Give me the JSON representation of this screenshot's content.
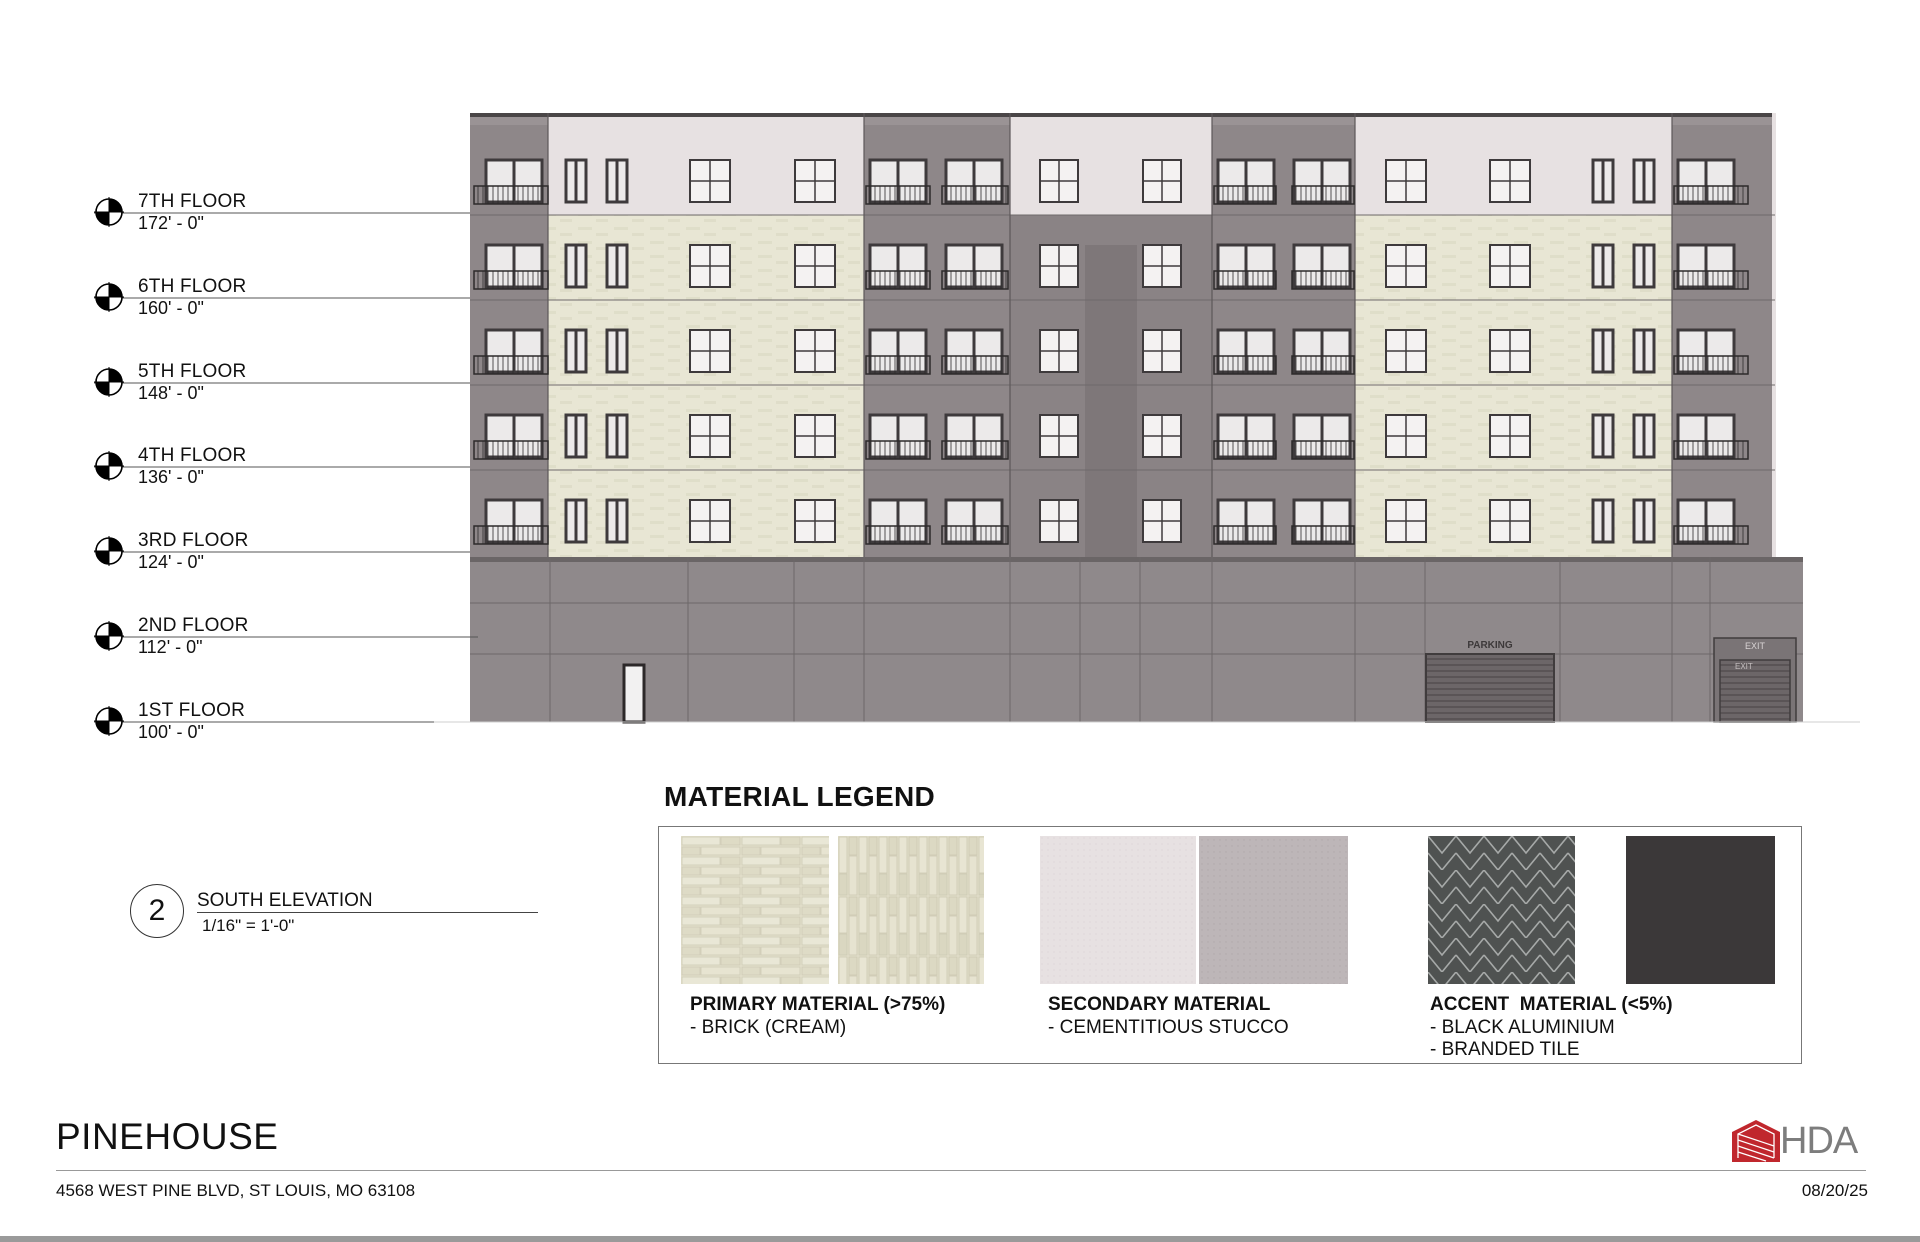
{
  "levels": [
    {
      "name": "7TH FLOOR",
      "elevation": "172' - 0\""
    },
    {
      "name": "6TH FLOOR",
      "elevation": "160' - 0\""
    },
    {
      "name": "5TH FLOOR",
      "elevation": "148' - 0\""
    },
    {
      "name": "4TH FLOOR",
      "elevation": "136' - 0\""
    },
    {
      "name": "3RD FLOOR",
      "elevation": "124' - 0\""
    },
    {
      "name": "2ND FLOOR",
      "elevation": "112' - 0\""
    },
    {
      "name": "1ST FLOOR",
      "elevation": "100' - 0\""
    }
  ],
  "view": {
    "number": "2",
    "title": "SOUTH ELEVATION",
    "scale": "1/16\" = 1'-0\""
  },
  "building": {
    "parking_label": "PARKING",
    "exit_label": "EXIT",
    "exit_label_2": "EXIT"
  },
  "legend": {
    "title": "MATERIAL LEGEND",
    "primary": {
      "title": "PRIMARY MATERIAL (>75%)",
      "lines": [
        "- BRICK (CREAM)"
      ]
    },
    "secondary": {
      "title": "SECONDARY MATERIAL",
      "lines": [
        "- CEMENTITIOUS STUCCO"
      ]
    },
    "accent": {
      "title": "ACCENT  MATERIAL (<5%)",
      "lines": [
        "- BLACK ALUMINIUM",
        "- BRANDED TILE"
      ]
    }
  },
  "colors": {
    "brick_cream": "#e8e6d4",
    "stucco_light": "#e7e1e2",
    "stucco_mid": "#bdb6b8",
    "dark_panel": "#8e8789",
    "mid_panel": "#9a9395",
    "base_panel": "#8f898b",
    "window_dark": "#3e3a3c",
    "accent_black": "#3b3839",
    "accent_tile": "#4f5251",
    "brand_red": "#c0272d",
    "brand_gray": "#7d7d7d"
  },
  "footer": {
    "project_name": "PINEHOUSE",
    "address": "4568 WEST PINE BLVD, ST LOUIS, MO 63108",
    "date": "08/20/25",
    "logo_text": "HDA"
  }
}
